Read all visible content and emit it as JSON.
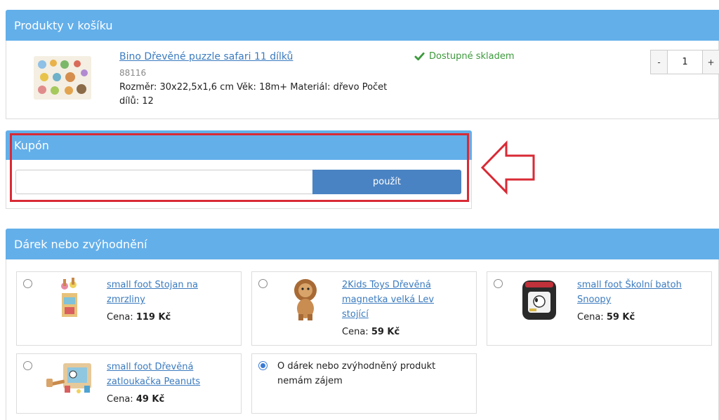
{
  "cart": {
    "title": "Produkty v košíku",
    "product": {
      "name": "Bino Dřevěné puzzle safari 11 dílků",
      "code": "88116",
      "description": "Rozměr: 30x22,5x1,6 cm Věk: 18m+ Materiál: dřevo Počet dílů: 12",
      "stock": "Dostupné skladem",
      "quantity": "1",
      "minus_label": "-",
      "plus_label": "+"
    }
  },
  "coupon": {
    "title": "Kupón",
    "input_value": "",
    "button_label": "použít"
  },
  "gifts": {
    "title": "Dárek nebo zvýhodnění",
    "price_prefix": "Cena:",
    "items": [
      {
        "name": "small foot Stojan na zmrzliny",
        "price": "119 Kč",
        "selected": false
      },
      {
        "name": "2Kids Toys Dřevěná magnetka velká Lev stojící",
        "price": "59 Kč",
        "selected": false
      },
      {
        "name": "small foot Školní batoh Snoopy",
        "price": "59 Kč",
        "selected": false
      },
      {
        "name": "small foot Dřevěná zatloukačka Peanuts",
        "price": "49 Kč",
        "selected": false
      }
    ],
    "no_gift_label": "O dárek nebo zvýhodněný produkt nemám zájem",
    "no_gift_selected": true
  },
  "colors": {
    "header_blue": "#63afea",
    "button_blue": "#4a83c3",
    "link_blue": "#3b7bbf",
    "stock_green": "#3c9a3c",
    "annotation_red": "#d92a35"
  },
  "icons": {
    "stock": "check-icon",
    "annotation": "arrow-left-outline"
  }
}
